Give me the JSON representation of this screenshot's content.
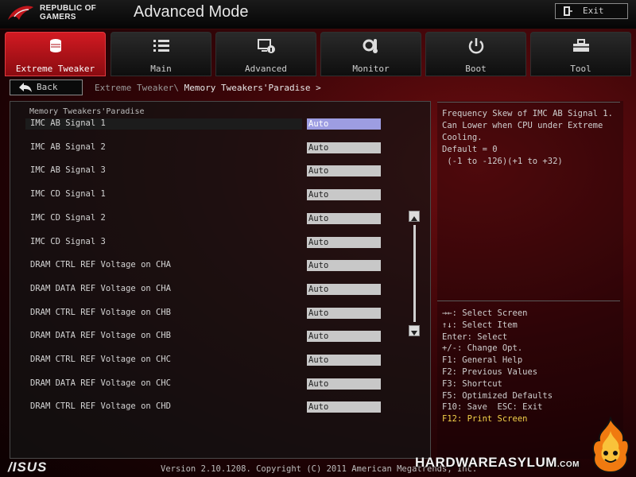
{
  "header": {
    "brand_line1": "REPUBLIC OF",
    "brand_line2": "GAMERS",
    "mode_title": "Advanced Mode",
    "exit_label": "Exit"
  },
  "tabs": [
    {
      "label": "Extreme Tweaker",
      "icon": "tweaker-icon",
      "active": true
    },
    {
      "label": "Main",
      "icon": "list-icon",
      "active": false
    },
    {
      "label": "Advanced",
      "icon": "advanced-icon",
      "active": false
    },
    {
      "label": "Monitor",
      "icon": "monitor-icon",
      "active": false
    },
    {
      "label": "Boot",
      "icon": "power-icon",
      "active": false
    },
    {
      "label": "Tool",
      "icon": "toolbox-icon",
      "active": false
    }
  ],
  "nav": {
    "back_label": "Back",
    "breadcrumb_parent": "Extreme Tweaker\\",
    "breadcrumb_current": " Memory Tweakers'Paradise >"
  },
  "section_title": "Memory Tweakers'Paradise",
  "settings": [
    {
      "label": "IMC AB Signal 1",
      "value": "Auto",
      "selected": true
    },
    {
      "label": "IMC AB Signal 2",
      "value": "Auto",
      "selected": false
    },
    {
      "label": "IMC AB Signal 3",
      "value": "Auto",
      "selected": false
    },
    {
      "label": "IMC CD Signal 1",
      "value": "Auto",
      "selected": false
    },
    {
      "label": "IMC CD Signal 2",
      "value": "Auto",
      "selected": false
    },
    {
      "label": "IMC CD Signal 3",
      "value": "Auto",
      "selected": false
    },
    {
      "label": "DRAM CTRL REF Voltage on CHA",
      "value": "Auto",
      "selected": false
    },
    {
      "label": "DRAM DATA REF Voltage on CHA",
      "value": "Auto",
      "selected": false
    },
    {
      "label": "DRAM CTRL REF Voltage on CHB",
      "value": "Auto",
      "selected": false
    },
    {
      "label": "DRAM DATA REF Voltage on CHB",
      "value": "Auto",
      "selected": false
    },
    {
      "label": "DRAM CTRL REF Voltage on CHC",
      "value": "Auto",
      "selected": false
    },
    {
      "label": "DRAM DATA REF Voltage on CHC",
      "value": "Auto",
      "selected": false
    },
    {
      "label": "DRAM CTRL REF Voltage on CHD",
      "value": "Auto",
      "selected": false
    }
  ],
  "help": {
    "lines": [
      "Frequency Skew of IMC AB Signal 1.",
      "Can Lower when CPU under Extreme",
      "Cooling.",
      "Default = 0",
      " (-1 to -126)(+1 to +32)"
    ]
  },
  "keys": [
    {
      "text": "→←: Select Screen",
      "highlight": false
    },
    {
      "text": "↑↓: Select Item",
      "highlight": false
    },
    {
      "text": "Enter: Select",
      "highlight": false
    },
    {
      "text": "+/-: Change Opt.",
      "highlight": false
    },
    {
      "text": "F1: General Help",
      "highlight": false
    },
    {
      "text": "F2: Previous Values",
      "highlight": false
    },
    {
      "text": "F3: Shortcut",
      "highlight": false
    },
    {
      "text": "F5: Optimized Defaults",
      "highlight": false
    },
    {
      "text": "F10: Save  ESC: Exit",
      "highlight": false
    },
    {
      "text": "F12: Print Screen",
      "highlight": true
    }
  ],
  "footer": {
    "asus_logo": "/ISUS",
    "version": "Version 2.10.1208. Copyright (C) 2011 American Megatrends, Inc.",
    "watermark_main": "HARDWAREASYLUM",
    "watermark_suffix": ".COM"
  },
  "colors": {
    "accent_red": "#d21a22",
    "selected_value": "#9d9de2",
    "highlight_key": "#f4d24a"
  }
}
